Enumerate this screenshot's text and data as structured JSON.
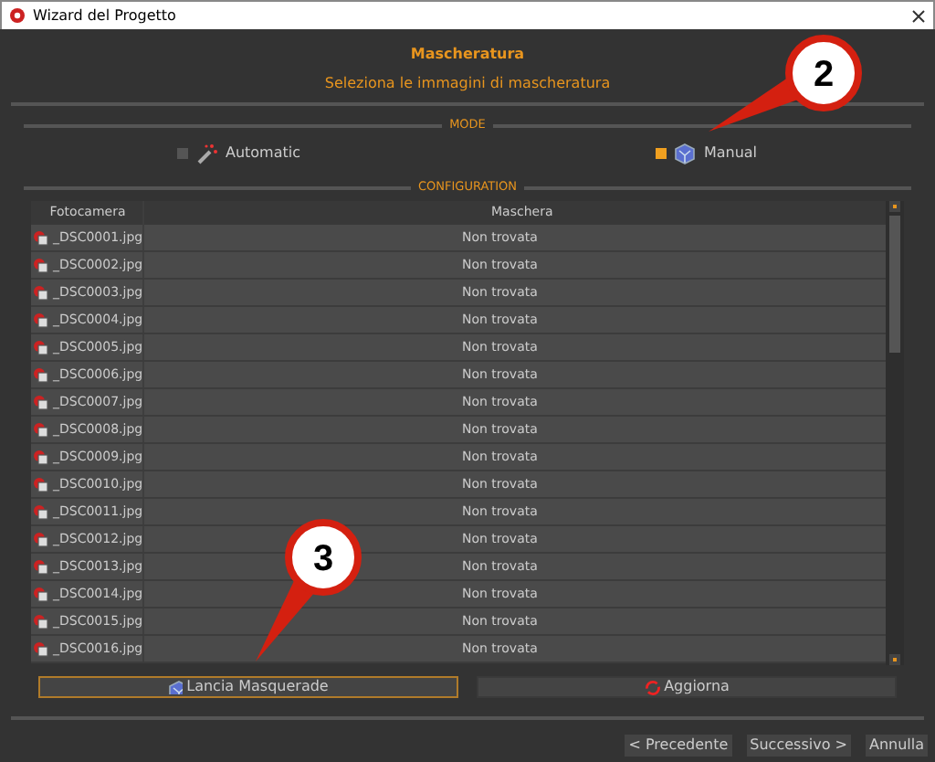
{
  "window": {
    "title": "Wizard del Progetto"
  },
  "header": {
    "title": "Mascheratura",
    "subtitle": "Seleziona le immagini di mascheratura"
  },
  "mode": {
    "label": "MODE",
    "options": [
      {
        "label": "Automatic",
        "kind": "wand",
        "selected": false
      },
      {
        "label": "Manual",
        "kind": "cube",
        "selected": true
      }
    ]
  },
  "configuration": {
    "label": "CONFIGURATION"
  },
  "table": {
    "columns": [
      "Fotocamera",
      "Maschera"
    ],
    "rows": [
      [
        "_DSC0001.jpg",
        "Non trovata"
      ],
      [
        "_DSC0002.jpg",
        "Non trovata"
      ],
      [
        "_DSC0003.jpg",
        "Non trovata"
      ],
      [
        "_DSC0004.jpg",
        "Non trovata"
      ],
      [
        "_DSC0005.jpg",
        "Non trovata"
      ],
      [
        "_DSC0006.jpg",
        "Non trovata"
      ],
      [
        "_DSC0007.jpg",
        "Non trovata"
      ],
      [
        "_DSC0008.jpg",
        "Non trovata"
      ],
      [
        "_DSC0009.jpg",
        "Non trovata"
      ],
      [
        "_DSC0010.jpg",
        "Non trovata"
      ],
      [
        "_DSC0011.jpg",
        "Non trovata"
      ],
      [
        "_DSC0012.jpg",
        "Non trovata"
      ],
      [
        "_DSC0013.jpg",
        "Non trovata"
      ],
      [
        "_DSC0014.jpg",
        "Non trovata"
      ],
      [
        "_DSC0015.jpg",
        "Non trovata"
      ],
      [
        "_DSC0016.jpg",
        "Non trovata"
      ]
    ]
  },
  "actions": [
    {
      "label": "Lancia Masquerade",
      "kind": "cube",
      "focused": true
    },
    {
      "label": "Aggiorna",
      "kind": "refresh",
      "focused": false
    }
  ],
  "footer": {
    "buttons": [
      "< Precedente",
      "Successivo >",
      "Annulla"
    ]
  },
  "callouts": [
    {
      "label": "2"
    },
    {
      "label": "3"
    }
  ]
}
